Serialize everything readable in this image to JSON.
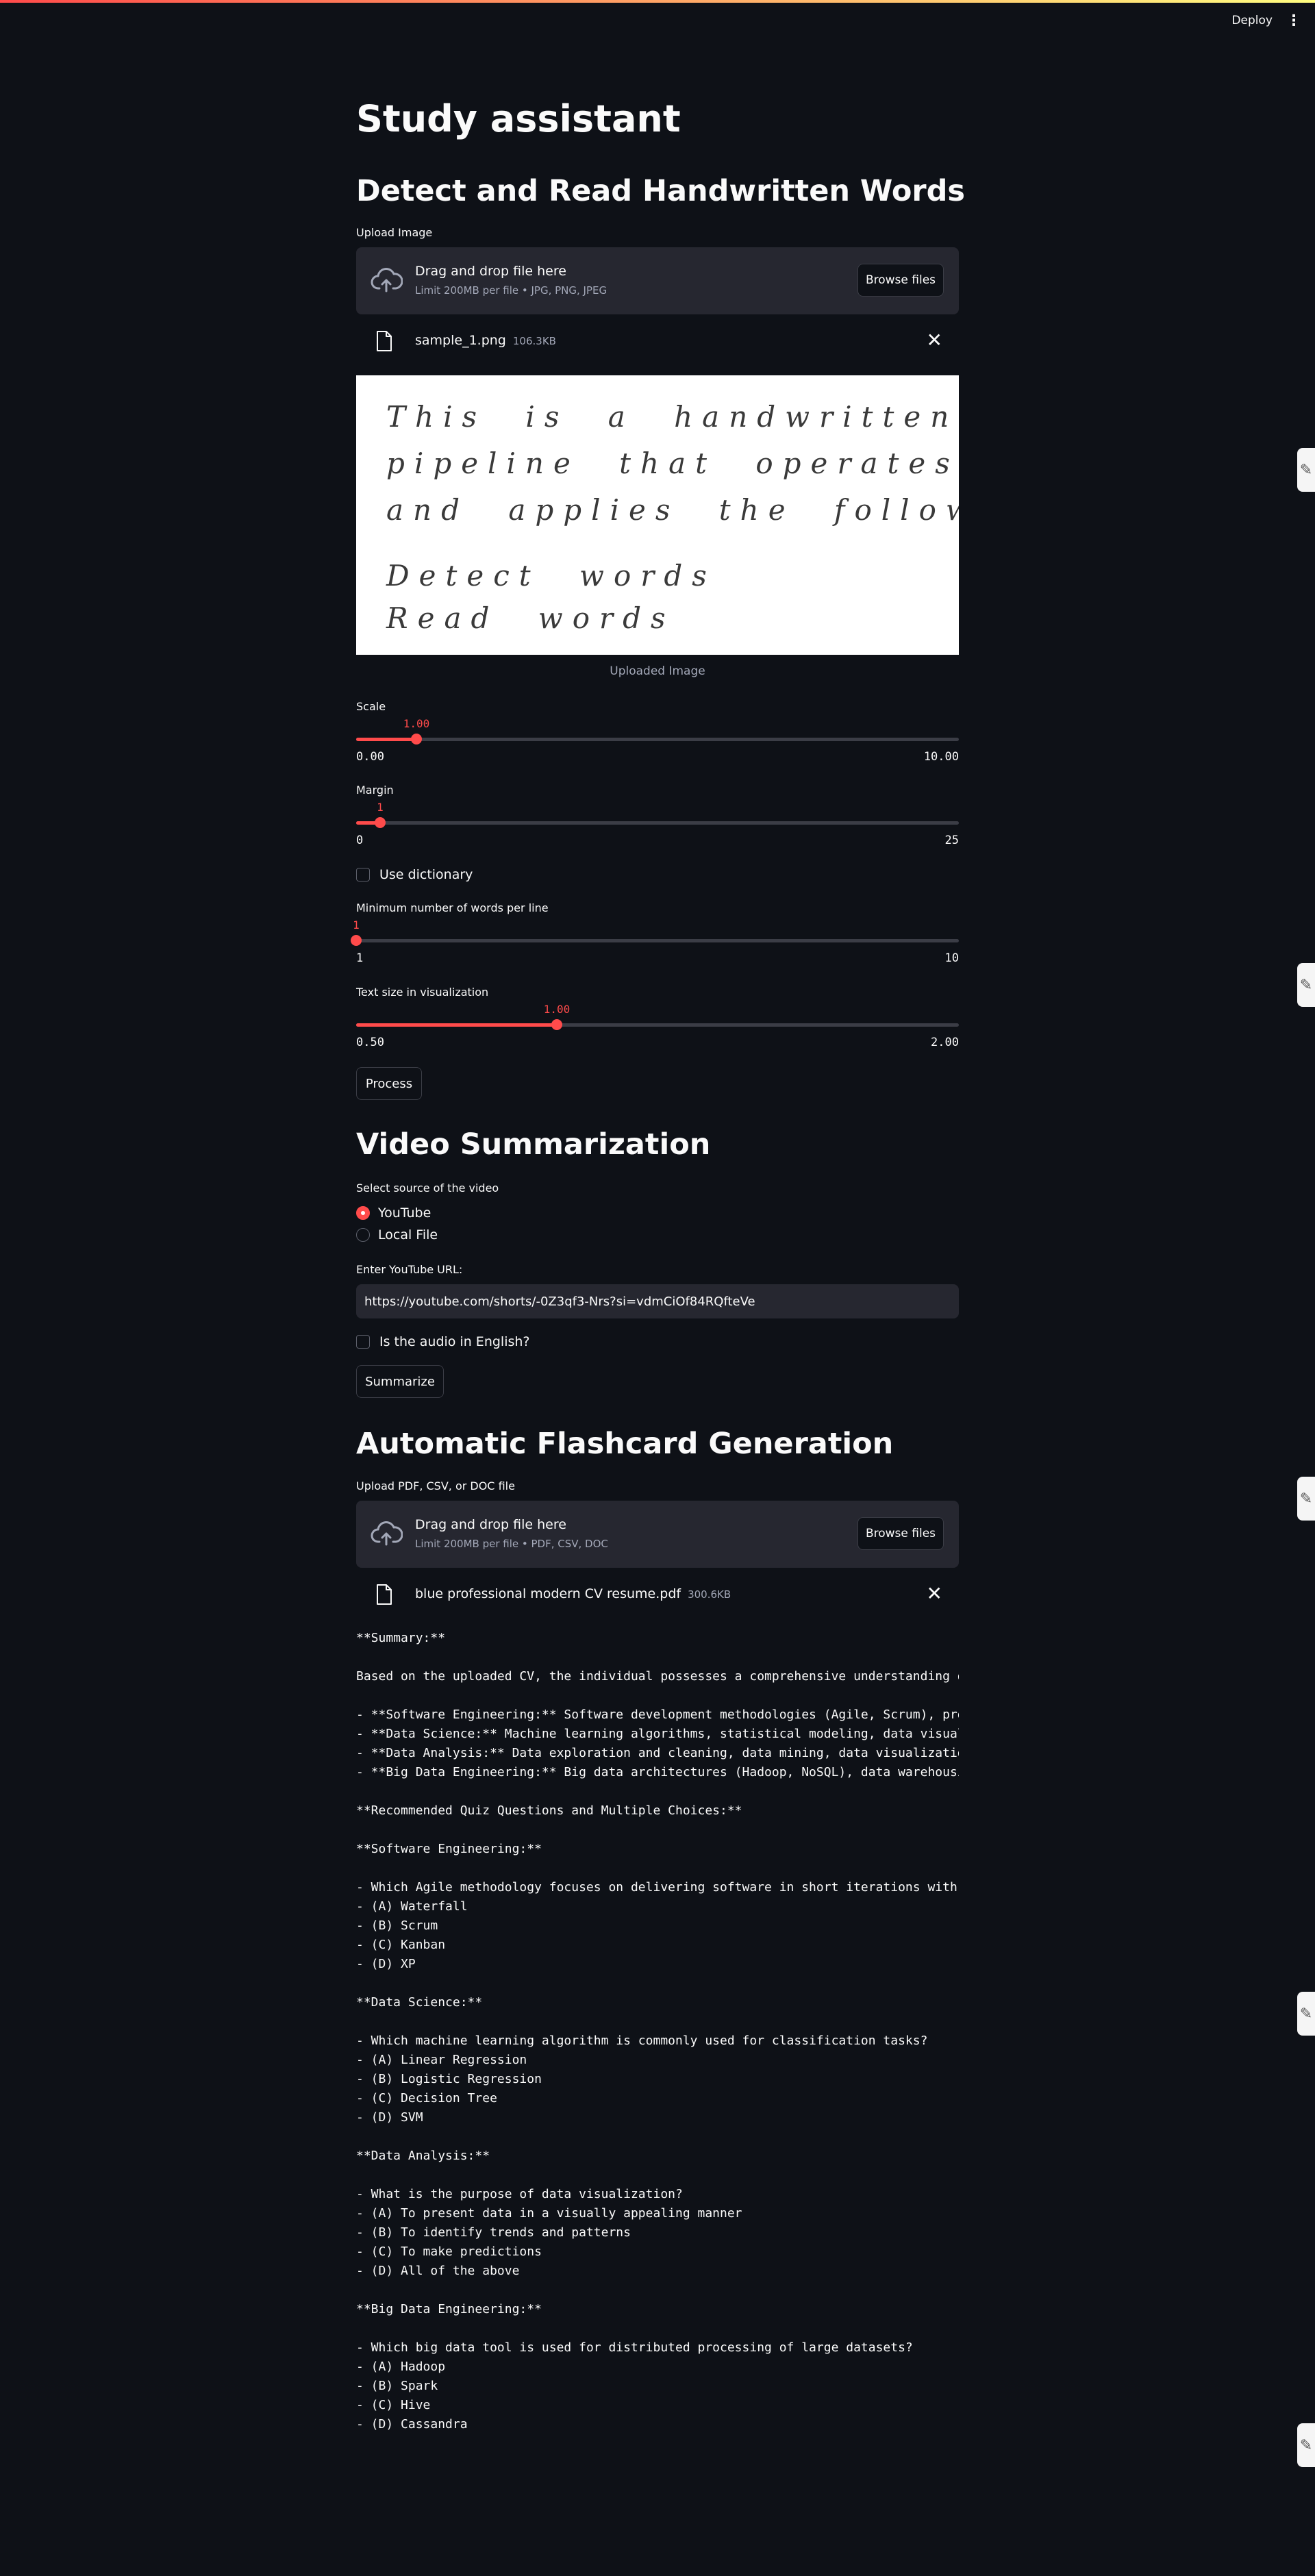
{
  "header": {
    "deploy_label": "Deploy",
    "menu_icon": "more-vertical-icon"
  },
  "title": "Study assistant",
  "handwritten": {
    "heading": "Detect and Read Handwritten Words",
    "upload_label": "Upload Image",
    "dropzone_text": "Drag and drop file here",
    "dropzone_limit": "Limit 200MB per file • JPG, PNG, JPEG",
    "browse_label": "Browse files",
    "file_name": "sample_1.png",
    "file_size": "106.3KB",
    "image_lines": [
      "This  is  a  handwritten  text  recognition",
      "pipeline  that  operates  on  scanned  pages",
      "and  applies  the  following  operations:",
      "Detect  words",
      "Read  words"
    ],
    "image_caption": "Uploaded Image",
    "scale": {
      "label": "Scale",
      "value": "1.00",
      "min": "0.00",
      "max": "10.00",
      "fraction": 0.1
    },
    "margin": {
      "label": "Margin",
      "value": "1",
      "min": "0",
      "max": "25",
      "fraction": 0.04
    },
    "dictionary_label": "Use dictionary",
    "min_words": {
      "label": "Minimum number of words per line",
      "value": "1",
      "min": "1",
      "max": "10",
      "fraction": 0
    },
    "text_size": {
      "label": "Text size in visualization",
      "value": "1.00",
      "min": "0.50",
      "max": "2.00",
      "fraction": 0.3333
    },
    "process_label": "Process"
  },
  "video": {
    "heading": "Video Summarization",
    "source_label": "Select source of the video",
    "options": [
      "YouTube",
      "Local File"
    ],
    "selected": "YouTube",
    "url_label": "Enter YouTube URL:",
    "url_value": "https://youtube.com/shorts/-0Z3qf3-Nrs?si=vdmCiOf84RQfteVe",
    "english_label": "Is the audio in English?",
    "summarize_label": "Summarize"
  },
  "flashcards": {
    "heading": "Automatic Flashcard Generation",
    "upload_label": "Upload PDF, CSV, or DOC file",
    "dropzone_text": "Drag and drop file here",
    "dropzone_limit": "Limit 200MB per file • PDF, CSV, DOC",
    "browse_label": "Browse files",
    "file_name": "blue professional modern CV resume.pdf",
    "file_size": "300.6KB",
    "output_lines": [
      "**Summary:**",
      "",
      "Based on the uploaded CV, the individual possesses a comprehensive understanding of",
      "",
      "- **Software Engineering:** Software development methodologies (Agile, Scrum), progr",
      "- **Data Science:** Machine learning algorithms, statistical modeling, data visualiz",
      "- **Data Analysis:** Data exploration and cleaning, data mining, data visualization,",
      "- **Big Data Engineering:** Big data architectures (Hadoop, NoSQL), data warehousing",
      "",
      "**Recommended Quiz Questions and Multiple Choices:**",
      "",
      "**Software Engineering:**",
      "",
      "- Which Agile methodology focuses on delivering software in short iterations with fr",
      "- (A) Waterfall",
      "- (B) Scrum",
      "- (C) Kanban",
      "- (D) XP",
      "",
      "**Data Science:**",
      "",
      "- Which machine learning algorithm is commonly used for classification tasks?",
      "- (A) Linear Regression",
      "- (B) Logistic Regression",
      "- (C) Decision Tree",
      "- (D) SVM",
      "",
      "**Data Analysis:**",
      "",
      "- What is the purpose of data visualization?",
      "- (A) To present data in a visually appealing manner",
      "- (B) To identify trends and patterns",
      "- (C) To make predictions",
      "- (D) All of the above",
      "",
      "**Big Data Engineering:**",
      "",
      "- Which big data tool is used for distributed processing of large datasets?",
      "- (A) Hadoop",
      "- (B) Spark",
      "- (C) Hive",
      "- (D) Cassandra"
    ]
  },
  "colors": {
    "background": "#0e1117",
    "accent": "#ff4b4b",
    "widget": "#262730"
  }
}
